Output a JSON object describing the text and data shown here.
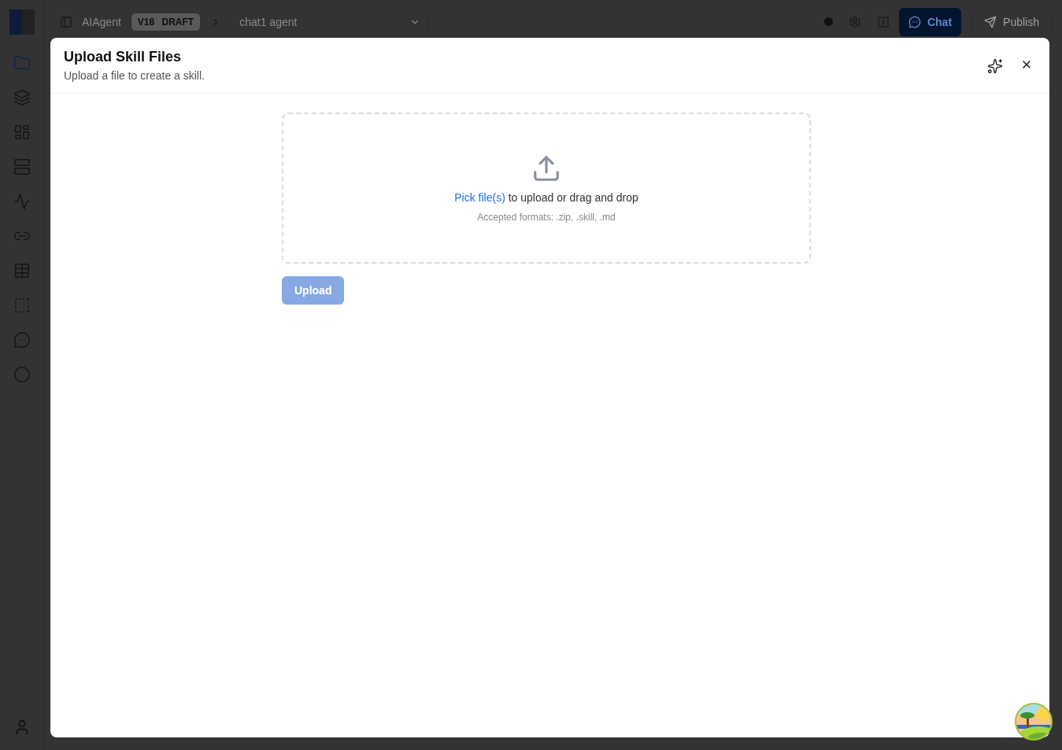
{
  "header": {
    "breadcrumb": "AIAgent",
    "version": "V18",
    "status": "DRAFT",
    "agent_select": {
      "value": "chat1 agent"
    },
    "chat_button": "Chat",
    "publish_button": "Publish"
  },
  "sidebar": {
    "items": [
      {
        "selected": true
      },
      {
        "selected": false
      },
      {
        "selected": false
      },
      {
        "selected": false
      },
      {
        "selected": false
      },
      {
        "selected": false
      },
      {
        "selected": false
      },
      {
        "selected": false
      },
      {
        "selected": false
      },
      {
        "selected": false
      }
    ]
  },
  "dialog": {
    "title": "Upload Skill Files",
    "subtitle": "Upload a file to create a skill.",
    "dropzone": {
      "link": "Pick file(s)",
      "text": "to upload or drag and drop",
      "hint": "Accepted formats: .zip, .skill, .md"
    },
    "upload_button": {
      "label": "Upload",
      "disabled": true
    }
  }
}
